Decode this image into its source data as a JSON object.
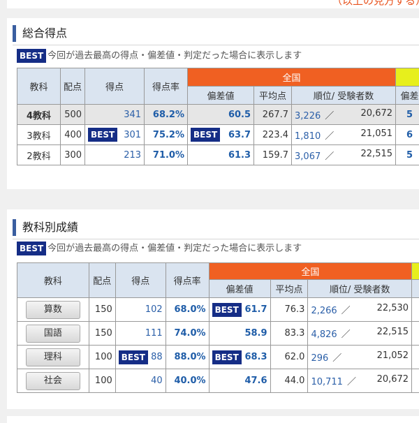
{
  "top_link": "（以上の見方する）",
  "summary": {
    "title": "総合得点",
    "best_label": "BEST",
    "note": "今回が過去最高の得点・偏差値・判定だった場合に表示します",
    "headers": {
      "subject": "教科",
      "max": "配点",
      "score": "得点",
      "rate": "得点率",
      "zenkoku": "全国",
      "hensachi": "偏差値",
      "avg": "平均点",
      "rank": "順位/ 受験者数",
      "extra": "偏差"
    },
    "rows": [
      {
        "subject": "4教科",
        "max": "500",
        "score": "341",
        "rate": "68.2%",
        "hensachi": "60.5",
        "avg": "267.7",
        "rank": "3,226",
        "sep": "／",
        "total": "20,672",
        "extra": "5",
        "score_best": false,
        "hensachi_best": false
      },
      {
        "subject": "3教科",
        "max": "400",
        "score": "301",
        "rate": "75.2%",
        "hensachi": "63.7",
        "avg": "223.4",
        "rank": "1,810",
        "sep": "／",
        "total": "21,051",
        "extra": "6",
        "score_best": true,
        "hensachi_best": true
      },
      {
        "subject": "2教科",
        "max": "300",
        "score": "213",
        "rate": "71.0%",
        "hensachi": "61.3",
        "avg": "159.7",
        "rank": "3,067",
        "sep": "／",
        "total": "22,515",
        "extra": "5",
        "score_best": false,
        "hensachi_best": false
      }
    ]
  },
  "subjects": {
    "title": "教科別成績",
    "best_label": "BEST",
    "note": "今回が過去最高の得点・偏差値・判定だった場合に表示します",
    "headers": {
      "subject": "教科",
      "max": "配点",
      "score": "得点",
      "rate": "得点率",
      "zenkoku": "全国",
      "hensachi": "偏差値",
      "avg": "平均点",
      "rank": "順位/ 受験者数"
    },
    "rows": [
      {
        "subject": "算数",
        "max": "150",
        "score": "102",
        "rate": "68.0%",
        "hensachi": "61.7",
        "avg": "76.3",
        "rank": "2,266",
        "sep": "／",
        "total": "22,530",
        "score_best": false,
        "hensachi_best": true
      },
      {
        "subject": "国語",
        "max": "150",
        "score": "111",
        "rate": "74.0%",
        "hensachi": "58.9",
        "avg": "83.3",
        "rank": "4,826",
        "sep": "／",
        "total": "22,515",
        "score_best": false,
        "hensachi_best": false
      },
      {
        "subject": "理科",
        "max": "100",
        "score": "88",
        "rate": "88.0%",
        "hensachi": "68.3",
        "avg": "62.0",
        "rank": "296",
        "sep": "／",
        "total": "21,052",
        "score_best": true,
        "hensachi_best": true
      },
      {
        "subject": "社会",
        "max": "100",
        "score": "40",
        "rate": "40.0%",
        "hensachi": "47.6",
        "avg": "44.0",
        "rank": "10,711",
        "sep": "／",
        "total": "20,672",
        "score_best": false,
        "hensachi_best": false
      }
    ]
  }
}
